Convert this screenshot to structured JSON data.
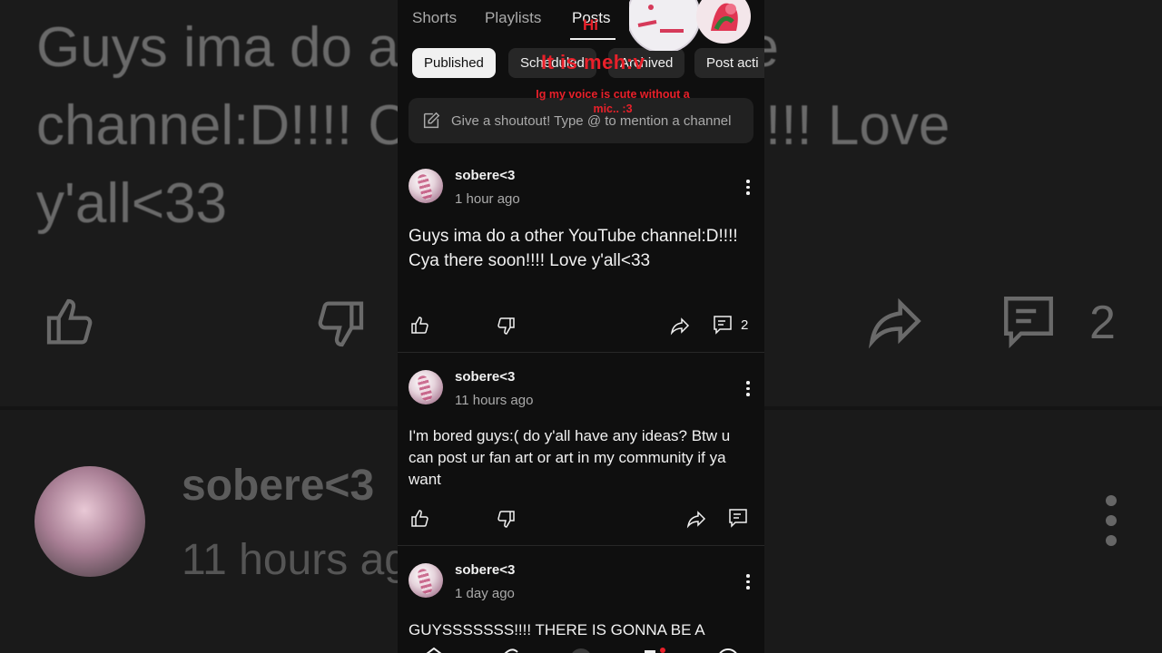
{
  "background": {
    "post_text": "Guys ima do a other YouTube channel:D!!!! Cya there soon!!!! Love y'all<33",
    "comment_count": "2",
    "author": "sobere<3",
    "time": "11 hours ago"
  },
  "tabs": [
    {
      "label": "Shorts",
      "active": false
    },
    {
      "label": "Playlists",
      "active": false
    },
    {
      "label": "Posts",
      "active": true
    }
  ],
  "filters": [
    {
      "label": "Published",
      "selected": true
    },
    {
      "label": "Scheduled",
      "selected": false
    },
    {
      "label": "Archived",
      "selected": false
    },
    {
      "label": "Post acti",
      "selected": false
    }
  ],
  "shoutout": {
    "placeholder": "Give a shoutout! Type @ to mention a channel"
  },
  "posts": [
    {
      "author": "sobere<3",
      "time": "1 hour ago",
      "text": "Guys ima do a other YouTube channel:D!!!! Cya there soon!!!! Love y'all<33",
      "comment_count": "2"
    },
    {
      "author": "sobere<3",
      "time": "11 hours ago",
      "text": "I'm bored guys:( do y'all have any ideas? Btw u can post ur fan art or art in my community if ya want",
      "comment_count": ""
    },
    {
      "author": "sobere<3",
      "time": "1 day ago",
      "text": "GUYSSSSSSS!!!! THERE IS GONNA BE A",
      "comment_count": ""
    }
  ],
  "overlay": {
    "title": "It is meh:v",
    "subtitle": "Ig my voice is cute without a mic.. :3",
    "greeting": "Hi"
  },
  "colors": {
    "overlay_red": "#e8202a",
    "background": "#0f0f0f",
    "chip_bg": "#272727"
  }
}
